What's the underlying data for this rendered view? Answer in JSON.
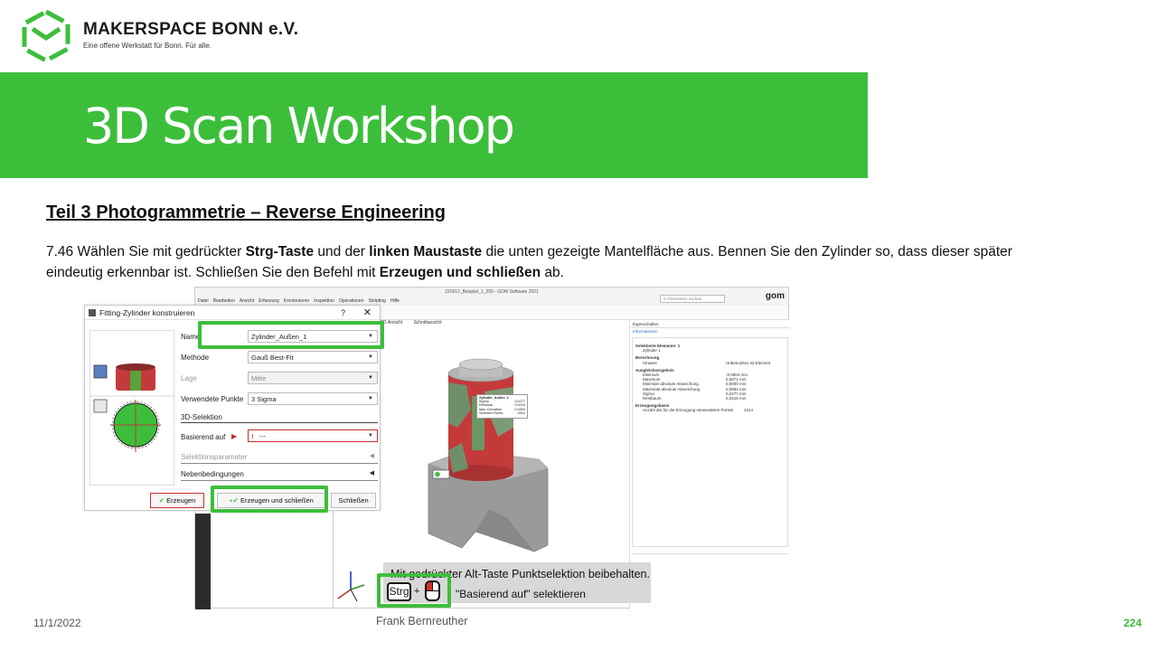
{
  "colors": {
    "brand_green": "#3dbe3b",
    "highlight_green": "#3dbe3b",
    "title_text": "#ffffff"
  },
  "header": {
    "brand_name": "MAKERSPACE BONN e.V.",
    "tagline": "Eine offene Werkstatt für Bonn. Für alle.",
    "logo_icon": "makerspace-cube-logo"
  },
  "title": "3D Scan Workshop",
  "section_title": "Teil 3  Photogrammetrie  – Reverse Engineering",
  "instructions": {
    "p1": "7.46 Wählen Sie mit gedrückter ",
    "b1": "Strg-Taste",
    "p2": " und der ",
    "b2": "linken Maustaste",
    "p3": " die unten gezeigte Mantelfläche aus. Bennen Sie den Zylinder so, dass dieser später eindeutig erkennbar ist. Schließen Sie den Befehl mit ",
    "b3": "Erzeugen und schließen",
    "p4": " ab."
  },
  "app": {
    "title": "220912_Beispiel_1_200 - GOM Software 2021",
    "menu": [
      "Datei",
      "Bearbeiten",
      "Ansicht",
      "Erfassung",
      "Konstruieren",
      "Inspektion",
      "Operationen",
      "Skripting",
      "Hilfe"
    ],
    "search_placeholder": "In Elementen suchen",
    "logo": "gom",
    "tabs": [
      "3D-Ansicht",
      "Schnittansicht"
    ],
    "props": {
      "tab": "Eigenschaften",
      "subtab": "Informationen",
      "sections": [
        {
          "heading": "Selektierte Elemente: 1",
          "rows": [
            [
              "Zylinder 1",
              ""
            ]
          ]
        },
        {
          "heading": "Berechnung",
          "rows": [
            [
              "Hinweis",
              "Unbenutztes Ist-Element"
            ]
          ]
        },
        {
          "heading": "Ausgleichsergebnis",
          "rows": [
            [
              "Minimum",
              "-0,0863 mm"
            ],
            [
              "Maximum",
              "0,0871 mm"
            ],
            [
              "Minimale absolute Abweichung",
              "0,0000 mm"
            ],
            [
              "Maximale absolute Abweichung",
              "0,0993 mm"
            ],
            [
              "Sigma",
              "0,0277 mm"
            ],
            [
              "Restbaum",
              "0,0216 mm"
            ]
          ]
        },
        {
          "heading": "Erzeugungsbasis",
          "rows": [
            [
              "Anzahl der für die Erzeugung verwendeten Punkte",
              "3314"
            ]
          ]
        }
      ]
    },
    "callout": {
      "title": "Zylinder_Außen_1",
      "rows": [
        [
          "Sigma",
          "0,0277"
        ],
        [
          "Residual",
          "0,0216"
        ],
        [
          "Max. Deviation",
          "0,0993"
        ],
        [
          "Selected Points",
          "3314"
        ]
      ]
    }
  },
  "dialog": {
    "title": "Fitting-Zylinder konstruieren",
    "help": "?",
    "close": "✕",
    "name_label": "Name",
    "name_value": "Zylinder_Außen_1",
    "method_label": "Methode",
    "method_value": "Gauß Best-Fit",
    "position_label": "Lage",
    "position_value": "Mitte",
    "points_label": "Verwendete Punkte",
    "points_value": "3 Sigma",
    "selection_section": "3D-Selektion",
    "based_on_label": "Basierend auf",
    "based_on_value": "---",
    "selection_params": "Selektionsparameter",
    "constraints": "Nebenbedingungen",
    "btn_create": "Erzeugen",
    "btn_create_close": "Erzeugen und schließen",
    "btn_close": "Schließen"
  },
  "hint": {
    "line1": "Mit gedrückter Alt-Taste Punktselektion beibehalten.",
    "line2": "\"Basierend auf\" selektieren",
    "key": "Strg",
    "plus": "+"
  },
  "footer": {
    "date": "11/1/2022",
    "author": "Frank Bernreuther",
    "page": "224"
  }
}
